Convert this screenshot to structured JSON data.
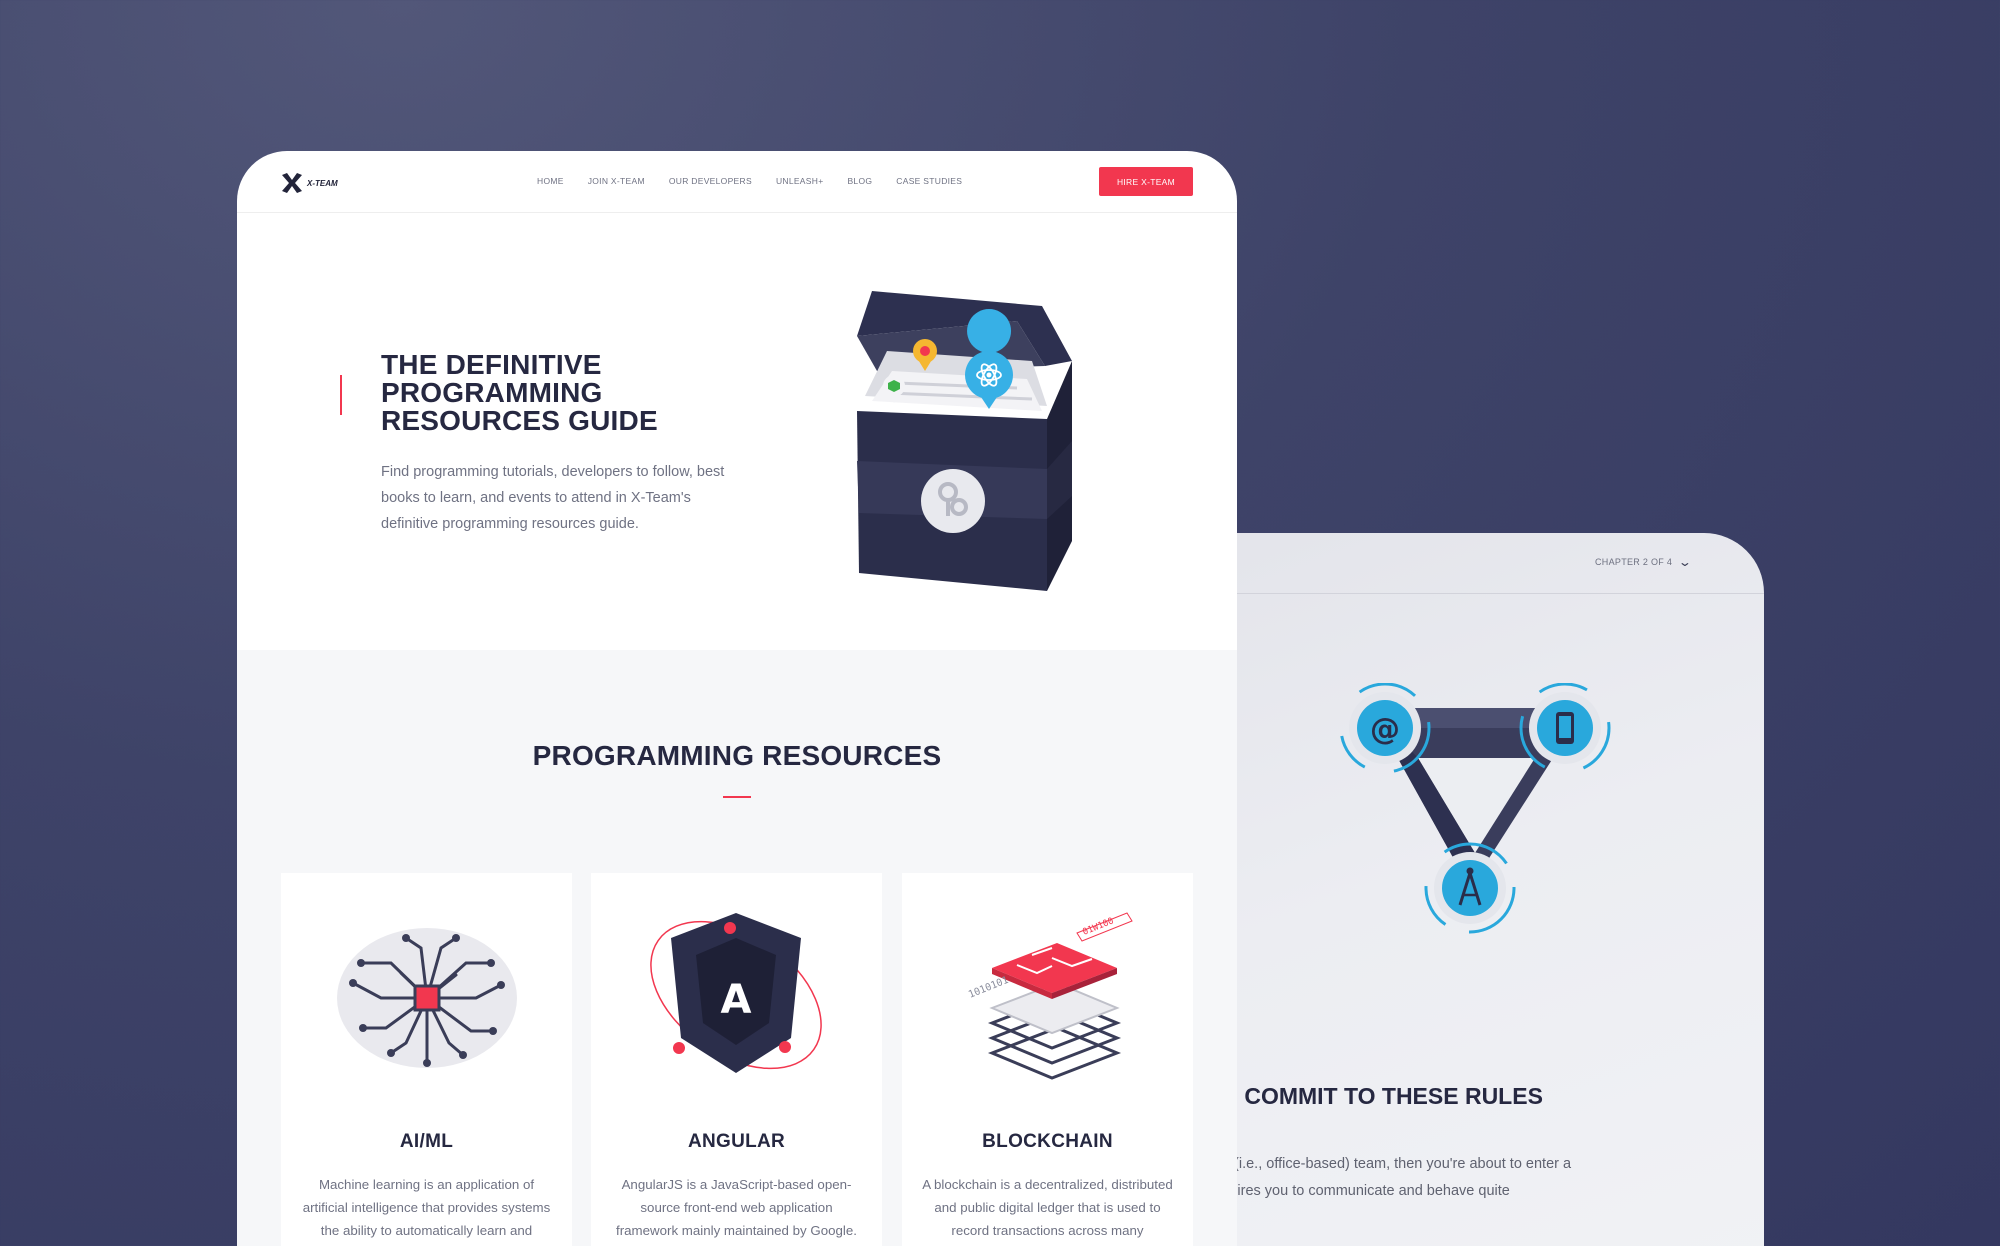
{
  "colors": {
    "accent": "#f2374f",
    "dark": "#262841",
    "cyan": "#29a8dc"
  },
  "back_page": {
    "chapter_label": "CHAPTER 2 OF 4",
    "chevron_icon": "chevron-down-icon",
    "heading": "THING, COMMIT TO THESE RULES",
    "paragraph_line1": "a 'physical' (i.e., office-based) team, then you're about to enter a",
    "paragraph_line2": "ne that requires you to communicate and behave quite",
    "illustration_icons": [
      "at-sign-icon",
      "smartphone-icon",
      "signal-tower-icon"
    ]
  },
  "front_page": {
    "logo_text": "X-TEAM",
    "nav_items": [
      "HOME",
      "JOIN X-TEAM",
      "OUR DEVELOPERS",
      "UNLEASH+",
      "BLOG",
      "CASE STUDIES"
    ],
    "cta_label": "HIRE X-TEAM",
    "hero": {
      "title_line1": "THE DEFINITIVE",
      "title_line2": "PROGRAMMING",
      "title_line3": "RESOURCES GUIDE",
      "desc_line1": "Find programming tutorials, developers to follow, best",
      "desc_line2": "books to learn, and events to attend in X-Team's",
      "desc_line3": "definitive programming resources guide."
    },
    "section_title": "PROGRAMMING RESOURCES",
    "cards": [
      {
        "title": "AI/ML",
        "icon": "brain-circuit-icon",
        "desc_line1": "Machine learning is an application of",
        "desc_line2": "artificial intelligence that provides systems",
        "desc_line3": "the ability to automatically learn and"
      },
      {
        "title": "ANGULAR",
        "icon": "angular-shield-icon",
        "icon_letter": "A",
        "desc_line1": "AngularJS is a JavaScript-based open-",
        "desc_line2": "source front-end web application",
        "desc_line3": "framework mainly maintained by Google."
      },
      {
        "title": "BLOCKCHAIN",
        "icon": "blockchain-layers-icon",
        "art_text1": "1010101",
        "art_text2": "01W100",
        "desc_line1": "A blockchain is a decentralized, distributed",
        "desc_line2": "and public digital ledger that is used to",
        "desc_line3": "record transactions across many"
      }
    ]
  }
}
